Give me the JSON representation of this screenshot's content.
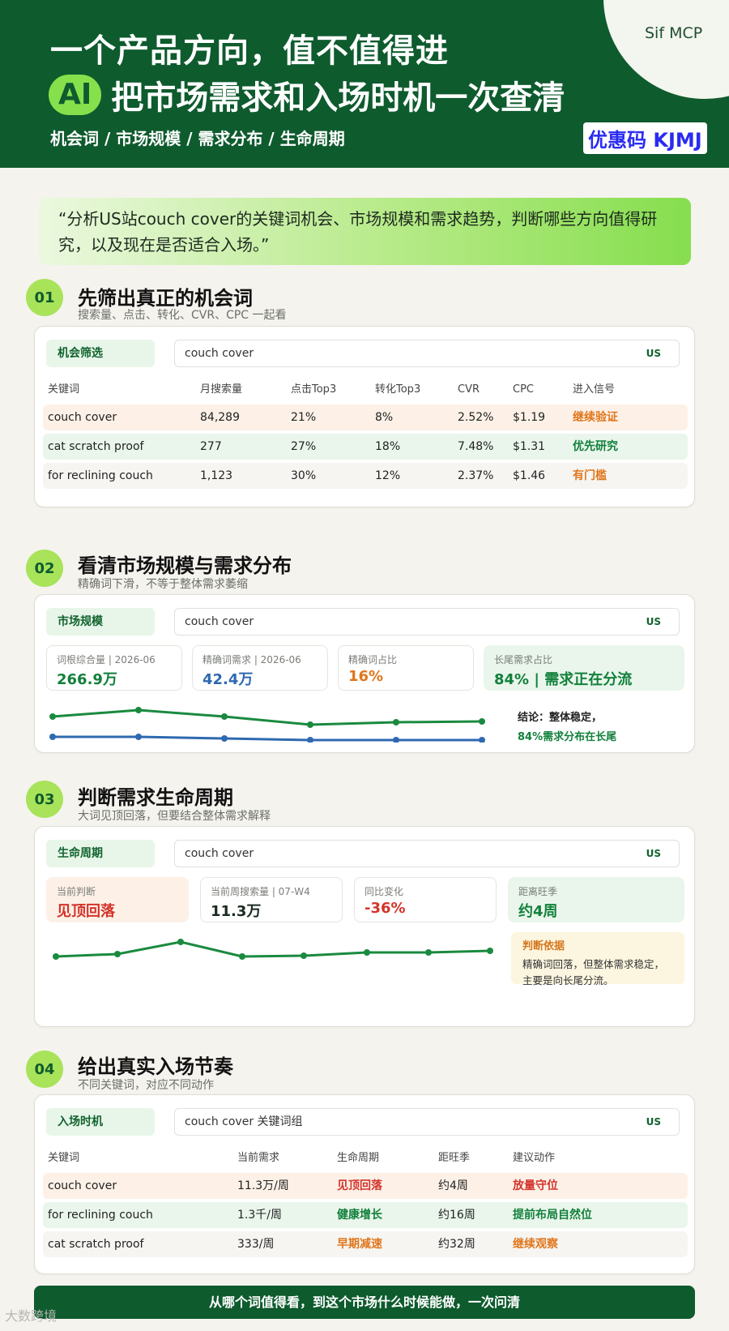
{
  "header": {
    "brand": "Sif MCP",
    "title_line1": "一个产品方向，值不值得进",
    "ai_badge": "AI",
    "title_line2": "把市场需求和入场时机一次查清",
    "tags": "机会词 / 市场规模 / 需求分布 / 生命周期",
    "promo": "优惠码 KJMJ"
  },
  "quote": "“分析US站couch cover的关键词机会、市场规模和需求趋势，判断哪些方向值得研究，以及现在是否适合入场。”",
  "step1": {
    "num": "01",
    "title": "先筛出真正的机会词",
    "subtitle": "搜索量、点击、转化、CVR、CPC 一起看",
    "pill": "机会筛选",
    "search_value": "couch cover",
    "country": "US",
    "columns": [
      "关键词",
      "月搜索量",
      "点击Top3",
      "转化Top3",
      "CVR",
      "CPC",
      "进入信号"
    ],
    "rows": [
      {
        "keyword": "couch cover",
        "volume": "84,289",
        "click": "21%",
        "conv": "8%",
        "cvr": "2.52%",
        "cpc": "$1.19",
        "signal": "继续验证"
      },
      {
        "keyword": "cat scratch proof",
        "volume": "277",
        "click": "27%",
        "conv": "18%",
        "cvr": "7.48%",
        "cpc": "$1.31",
        "signal": "优先研究"
      },
      {
        "keyword": "for reclining couch",
        "volume": "1,123",
        "click": "30%",
        "conv": "12%",
        "cvr": "2.37%",
        "cpc": "$1.46",
        "signal": "有门槛"
      }
    ]
  },
  "step2": {
    "num": "02",
    "title": "看清市场规模与需求分布",
    "subtitle": "精确词下滑，不等于整体需求萎缩",
    "pill": "市场规模",
    "search_value": "couch cover",
    "country": "US",
    "metrics": [
      {
        "label": "词根综合量 | 2026-06",
        "value": "266.9万"
      },
      {
        "label": "精确词需求 | 2026-06",
        "value": "42.4万"
      },
      {
        "label": "精确词占比",
        "value": "16%"
      },
      {
        "label": "长尾需求占比",
        "value": "84% | 需求正在分流"
      }
    ],
    "conclusion_line1": "结论：整体稳定，",
    "conclusion_line2": "84%需求分布在长尾",
    "colors": {
      "green_series": "#1a8a3f",
      "blue_series": "#2f69b0"
    }
  },
  "step3": {
    "num": "03",
    "title": "判断需求生命周期",
    "subtitle": "大词见顶回落，但要结合整体需求解释",
    "pill": "生命周期",
    "search_value": "couch cover",
    "country": "US",
    "metrics": [
      {
        "label": "当前判断",
        "value": "见顶回落"
      },
      {
        "label": "当前周搜索量 | 07-W4",
        "value": "11.3万"
      },
      {
        "label": "同比变化",
        "value": "-36%"
      },
      {
        "label": "距离旺季",
        "value": "约4周"
      }
    ],
    "basis_title": "判断依据",
    "basis_text": "精确词回落，但整体需求稳定，主要是向长尾分流。"
  },
  "step4": {
    "num": "04",
    "title": "给出真实入场节奏",
    "subtitle": "不同关键词，对应不同动作",
    "pill": "入场时机",
    "search_value": "couch cover 关键词组",
    "country": "US",
    "columns": [
      "关键词",
      "当前需求",
      "生命周期",
      "距旺季",
      "建议动作"
    ],
    "rows": [
      {
        "keyword": "couch cover",
        "demand": "11.3万/周",
        "cycle": "见顶回落",
        "season": "约4周",
        "action": "放量守位"
      },
      {
        "keyword": "for reclining couch",
        "demand": "1.3千/周",
        "cycle": "健康增长",
        "season": "约16周",
        "action": "提前布局自然位"
      },
      {
        "keyword": "cat scratch proof",
        "demand": "333/周",
        "cycle": "早期减速",
        "season": "约32周",
        "action": "继续观察"
      }
    ]
  },
  "footer": "从哪个词值得看，到这个市场什么时候能做，一次问清",
  "watermark": "大数跨境"
}
